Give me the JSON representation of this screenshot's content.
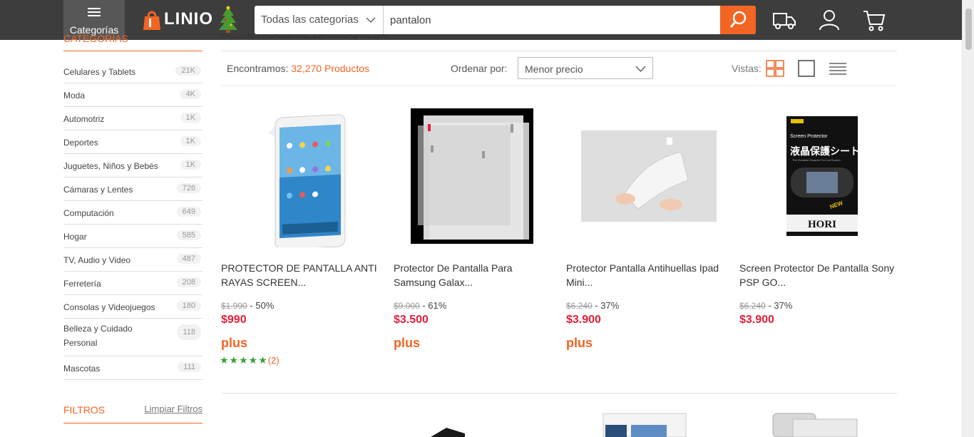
{
  "header": {
    "categories_button": "Categorías",
    "logo_text": "LINIO",
    "search": {
      "category": "Todas las categorias",
      "query": "pantalon"
    }
  },
  "sidebar": {
    "title": "CATEGORÍAS",
    "items": [
      {
        "label": "Celulares y Tablets",
        "count": "21K"
      },
      {
        "label": "Moda",
        "count": "4K"
      },
      {
        "label": "Automotriz",
        "count": "1K"
      },
      {
        "label": "Deportes",
        "count": "1K"
      },
      {
        "label": "Juguetes, Niños y Bebés",
        "count": "1K"
      },
      {
        "label": "Cámaras y Lentes",
        "count": "726"
      },
      {
        "label": "Computación",
        "count": "649"
      },
      {
        "label": "Hogar",
        "count": "585"
      },
      {
        "label": "TV, Audio y Video",
        "count": "487"
      },
      {
        "label": "Ferretería",
        "count": "208"
      },
      {
        "label": "Consolas y Videojuegos",
        "count": "180"
      },
      {
        "label": "Belleza y Cuidado Personal",
        "count": "118"
      },
      {
        "label": "Mascotas",
        "count": "111"
      }
    ],
    "filters_title": "FILTROS",
    "clear_filters": "Limpiar Filtros"
  },
  "results": {
    "title": "RESULTADOS DE LA BÚSQUEDA",
    "found_prefix": "Encontramos:",
    "found_count": "32,270 Productos",
    "sort_label": "Ordenar por:",
    "sort_value": "Menor precio",
    "views_label": "Vistas:",
    "products": [
      {
        "name": "PROTECTOR DE PANTALLA ANTI RAYAS SCREEN...",
        "old_price": "$1.990",
        "discount": "- 50%",
        "price": "$990",
        "plus": "plus",
        "stars": "★★★★★",
        "reviews": "(2)"
      },
      {
        "name": "Protector De Pantalla Para Samsung Galax...",
        "old_price": "$9.000",
        "discount": "- 61%",
        "price": "$3.500",
        "plus": "plus"
      },
      {
        "name": "Protector Pantalla Antihuellas Ipad Mini...",
        "old_price": "$6.240",
        "discount": "- 37%",
        "price": "$3.900",
        "plus": "plus"
      },
      {
        "name": "Screen Protector De Pantalla Sony PSP GO...",
        "old_price": "$6.240",
        "discount": "- 37%",
        "price": "$3.900"
      }
    ],
    "product4_box_title": "Screen Protector",
    "product4_box_jp": "液晶保護シート",
    "product4_box_tagline": "The Greatest Guarder For Lcd Screen",
    "product4_box_brand": "HORI",
    "product4_box_new": "NEW"
  },
  "colors": {
    "accent": "#f26522",
    "price": "#e0203a",
    "stars": "#3aa034",
    "topbar": "#3d3d3d"
  }
}
